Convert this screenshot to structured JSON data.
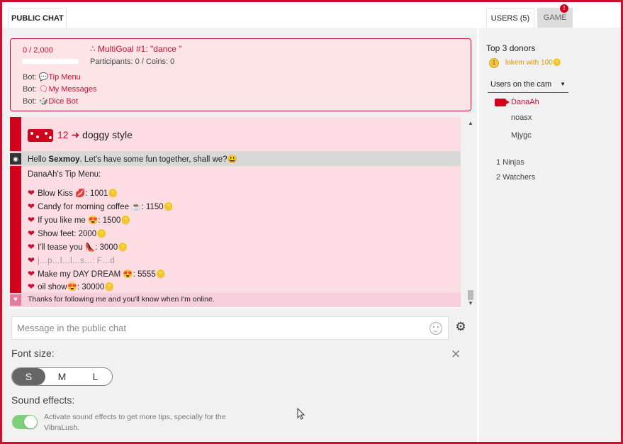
{
  "tabs": {
    "public_chat": "PUBLIC CHAT",
    "users": "USERS (5)",
    "game": "GAME",
    "game_badge": "!"
  },
  "goal": {
    "count": "0 / 2,000",
    "title": "MultiGoal #1: \"dance \"",
    "icon": "∴",
    "stats": "Participants: 0  /  Coins: 0",
    "progress": 0
  },
  "bots": [
    {
      "prefix": "Bot: ",
      "icon": "💬",
      "label": "Tip Menu"
    },
    {
      "prefix": "Bot: ",
      "icon": "🗨",
      "label": "My Messages"
    },
    {
      "prefix": "Bot: ",
      "icon": "🎲",
      "label": "Dice Bot"
    }
  ],
  "chat": {
    "dice_line": {
      "number": "12",
      "arrow": "➜",
      "text": "doggy style"
    },
    "hello_line": {
      "pre": "Hello ",
      "name": "Sexmoy",
      "post": ". Let's have some fun together, shall we?😃"
    },
    "tip_menu_title": "DanaAh's Tip Menu:",
    "tip_items": [
      "Blow Kiss 💋: 1001🪙",
      "Candy for morning coffee ☕: 1150🪙",
      "If you like me 😍: 1500🪙",
      "Show feet: 2000🪙",
      "I'll tease you 👠: 3000🪙",
      "j…p…l…l…s…: F…d",
      "Make my DAY DREAM 😍: 5555🪙",
      "oil show😍: 30000🪙"
    ],
    "follow_line": "Thanks for following me and you'll know when I'm online."
  },
  "input": {
    "placeholder": "Message in the public chat"
  },
  "settings": {
    "font_size_label": "Font size:",
    "sizes": [
      "S",
      "M",
      "L"
    ],
    "selected_size": "S",
    "sound_label": "Sound effects:",
    "sound_desc": "Activate sound effects to get more tips, specially for the VibraLush.",
    "sound_enabled": true
  },
  "right": {
    "top_donors_title": "Top 3 donors",
    "donor": "lokem with 100🪙",
    "coin_symbol": "1",
    "users_on_cam_label": "Users on the cam",
    "users": [
      "DanaAh",
      "noasx",
      "Mjygc"
    ],
    "ninjas": "1 Ninjas",
    "watchers": "2 Watchers"
  },
  "colors": {
    "accent": "#c8102e",
    "pink_bg": "#fcdde3"
  }
}
